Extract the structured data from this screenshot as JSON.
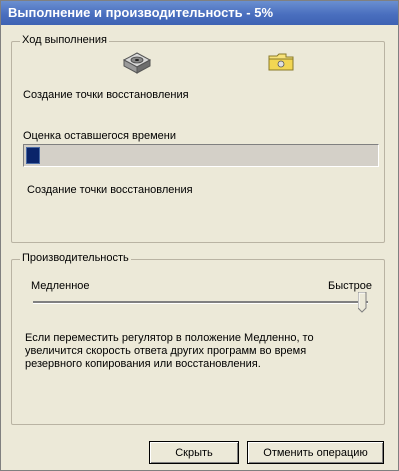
{
  "window": {
    "title": "Выполнение и производительность - 5%"
  },
  "progress_group": {
    "legend": "Ход выполнения",
    "icons": [
      "drive-icon",
      "folder-icon"
    ],
    "status_text": "Создание точки восстановления",
    "time_label": "Оценка оставшегося времени",
    "progress_percent": 5,
    "detail_text": "Создание точки восстановления"
  },
  "performance_group": {
    "legend": "Производительность",
    "slow_label": "Медленное",
    "fast_label": "Быстрое",
    "slider_value": "max",
    "description_line1": "Если переместить регулятор в положение Медленно, то",
    "description_line2": "увеличится скорость ответа других программ во время",
    "description_line3": "резервного копирования или восстановления."
  },
  "buttons": {
    "hide": "Скрыть",
    "cancel": "Отменить операцию"
  }
}
